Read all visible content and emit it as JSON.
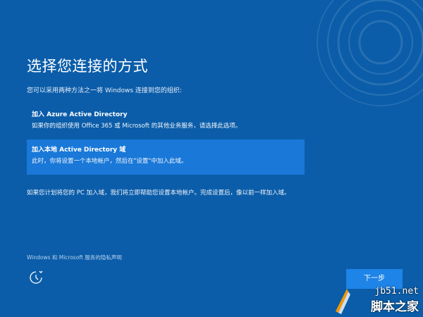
{
  "setup": {
    "title": "选择您连接的方式",
    "subtitle": "您可以采用两种方法之一将 Windows 连接到您的组织:",
    "options": [
      {
        "title": "加入 Azure Active Directory",
        "description": "如果你的组织使用 Office 365 或 Microsoft 的其他业务服务，请选择此选项。"
      },
      {
        "title": "加入本地 Active Directory 域",
        "description": "此时，你将设置一个本地帐户，然后在\"设置\"中加入此域。"
      }
    ],
    "note": "如果您计划将您的 PC 加入域，我们将立即帮助您设置本地帐户。完成设置后，像以前一样加入域。",
    "privacy_link": "Windows 和 Microsoft 服务的隐私声明",
    "next_label": "下一步"
  },
  "icons": {
    "accessibility": "ease-of-access-icon"
  },
  "colors": {
    "background": "#0b5da9",
    "selected": "#1978d8",
    "button": "#1e84e8"
  },
  "watermark": {
    "site": "jb51.net",
    "name": "脚本之家"
  }
}
